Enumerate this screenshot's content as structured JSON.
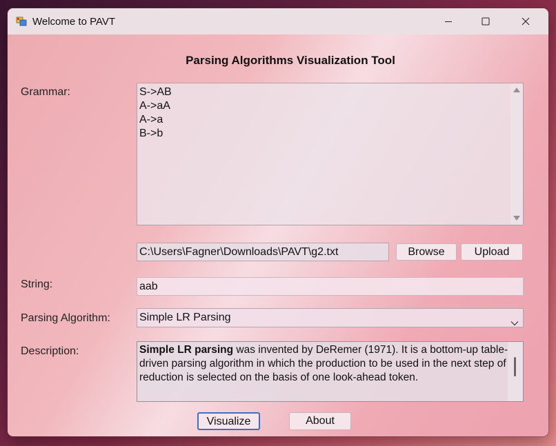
{
  "window": {
    "title": "Welcome to PAVT"
  },
  "main": {
    "heading": "Parsing Algorithms Visualization Tool",
    "grammar": {
      "label": "Grammar:",
      "lines": [
        "S->AB",
        "A->aA",
        "A->a",
        "B->b"
      ]
    },
    "file": {
      "path": "C:\\Users\\Fagner\\Downloads\\PAVT\\g2.txt",
      "browse_label": "Browse",
      "upload_label": "Upload"
    },
    "string": {
      "label": "String:",
      "value": "aab"
    },
    "algorithm": {
      "label": "Parsing Algorithm:",
      "selected": "Simple LR Parsing"
    },
    "description": {
      "label": "Description:",
      "bold_term": "Simple LR parsing",
      "text": " was invented by DeRemer (1971). It is a bottom-up table-driven parsing algorithm in which the production to be used in the next step of reduction is selected on the basis of one look-ahead token."
    },
    "actions": {
      "visualize_label": "Visualize",
      "about_label": "About"
    }
  },
  "colors": {
    "accent": "#3d6fc4",
    "titlebar": "#ebe0e4"
  },
  "icons": {
    "app": "app-window-icon",
    "minimize": "minimize-icon",
    "maximize": "maximize-icon",
    "close": "close-icon"
  }
}
